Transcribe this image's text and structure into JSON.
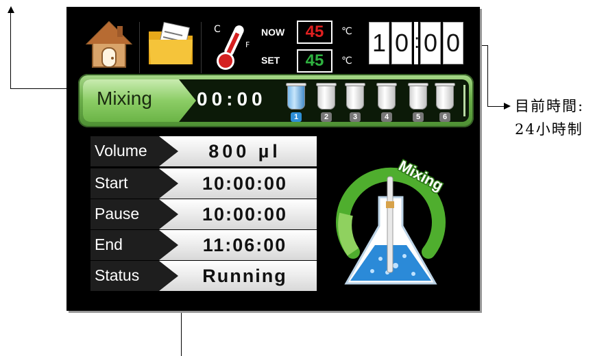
{
  "annotations": {
    "current_time_note_line1": "目前時間:",
    "current_time_note_line2": "24小時制"
  },
  "toolbar": {
    "home_icon": "home-icon",
    "folder_icon": "folder-icon",
    "thermometer_icon": "thermometer-icon",
    "now_label": "NOW",
    "set_label": "SET",
    "now_temp": "45",
    "set_temp": "45",
    "temp_unit": "℃",
    "clock": {
      "h1": "1",
      "h2": "0",
      "m1": "0",
      "m2": "0",
      "colon": ":"
    }
  },
  "statusbar": {
    "mode": "Mixing",
    "timer": "00:00",
    "active_tube": 1,
    "tubes": [
      "1",
      "2",
      "3",
      "4",
      "5",
      "6"
    ]
  },
  "info": {
    "rows": [
      {
        "label": "Volume",
        "value": "800 µl"
      },
      {
        "label": "Start",
        "value": "10:00:00"
      },
      {
        "label": "Pause",
        "value": "10:00:00"
      },
      {
        "label": "End",
        "value": "11:06:00"
      },
      {
        "label": "Status",
        "value": "Running"
      }
    ]
  },
  "graphic": {
    "badge_text": "Mixing"
  },
  "colors": {
    "now_temp": "#e02020",
    "set_temp": "#2fb340",
    "accent_green": "#6bb447",
    "active_tube": "#2e8fd6"
  }
}
